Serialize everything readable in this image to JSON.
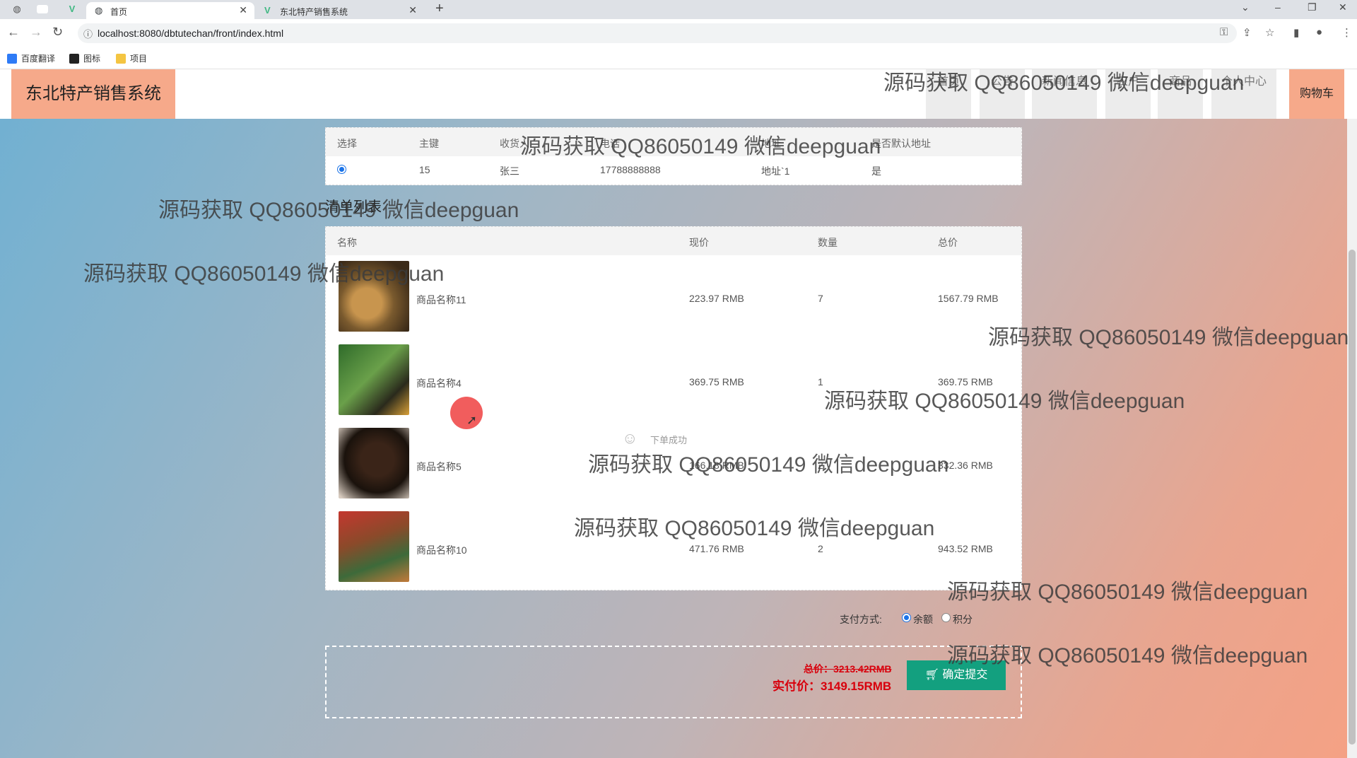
{
  "browser": {
    "tabs": [
      {
        "title": "首页",
        "active": true
      },
      {
        "title": "东北特产销售系统",
        "active": false
      }
    ],
    "url": "localhost:8080/dbtutechan/front/index.html",
    "bookmarks": [
      "百度翻译",
      "图标",
      "项目"
    ]
  },
  "site": {
    "logo": "东北特产销售系统",
    "nav": [
      "首页",
      "公告",
      "新闻信息",
      "农户",
      "商品",
      "个人中心",
      "购物车"
    ]
  },
  "address_table": {
    "headers": [
      "选择",
      "主键",
      "收货人",
      "电话",
      "地址",
      "是否默认地址"
    ],
    "rows": [
      {
        "selected": true,
        "id": "15",
        "name": "张三",
        "phone": "17788888888",
        "address": "地址`1",
        "default": "是"
      }
    ]
  },
  "list_title": "清单列表",
  "items_table": {
    "headers": [
      "名称",
      "现价",
      "数量",
      "总价"
    ],
    "rows": [
      {
        "name": "商品名称11",
        "price": "223.97 RMB",
        "qty": "7",
        "total": "1567.79 RMB"
      },
      {
        "name": "商品名称4",
        "price": "369.75 RMB",
        "qty": "1",
        "total": "369.75 RMB"
      },
      {
        "name": "商品名称5",
        "price": "166.18 RMB",
        "qty": "2",
        "total": "332.36 RMB"
      },
      {
        "name": "商品名称10",
        "price": "471.76 RMB",
        "qty": "2",
        "total": "943.52 RMB"
      }
    ]
  },
  "payment": {
    "label": "支付方式:",
    "options": [
      {
        "label": "余额",
        "checked": true
      },
      {
        "label": "积分",
        "checked": false
      }
    ]
  },
  "summary": {
    "total_label": "总价：3213.42RMB",
    "real_label": "实付价：3149.15RMB",
    "submit_label": "确定提交"
  },
  "toast": {
    "message": "下单成功"
  },
  "watermark": "源码获取 QQ86050149 微信deepguan",
  "colors": {
    "accent": "#f6a98a",
    "submit": "#13a07f",
    "price_red": "#d8000c"
  }
}
